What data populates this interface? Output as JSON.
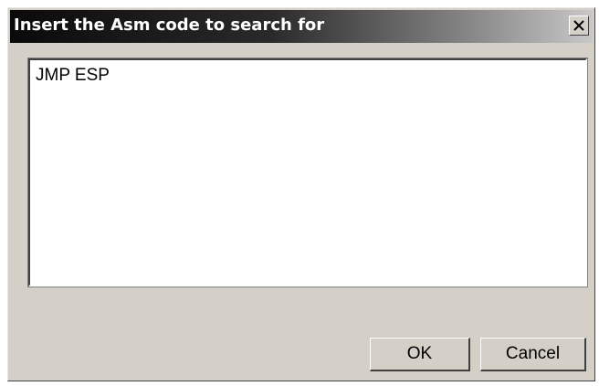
{
  "window": {
    "title": "Insert the Asm code to search for",
    "close_icon": "close-icon"
  },
  "editor": {
    "value": "JMP ESP"
  },
  "buttons": {
    "ok_label": "OK",
    "cancel_label": "Cancel"
  },
  "colors": {
    "face": "#d4d0c8",
    "titlebar_start": "#0a0a0a",
    "titlebar_end": "#c8c8c8",
    "text": "#000000"
  }
}
